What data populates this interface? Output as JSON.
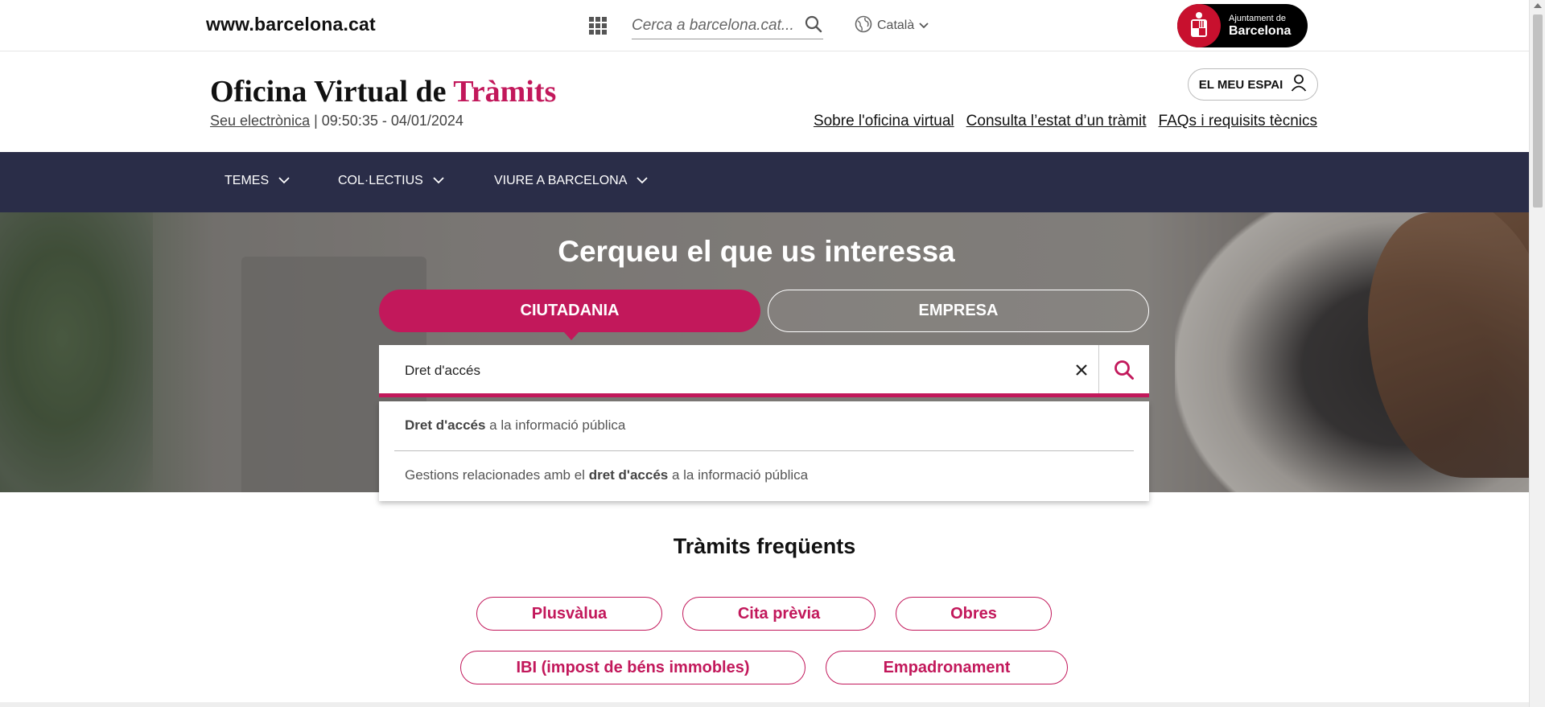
{
  "topbar": {
    "site_link": "www.barcelona.cat",
    "search_placeholder": "Cerca a barcelona.cat...",
    "language": "Català",
    "logo_line1": "Ajuntament de",
    "logo_line2": "Barcelona"
  },
  "header": {
    "title_part1": "Oficina Virtual de ",
    "title_part2": "Tràmits",
    "sub_link": "Seu electrònica",
    "datetime": "| 09:50:35 - 04/01/2024",
    "my_space": "EL MEU ESPAI",
    "links": [
      "Sobre l'oficina virtual",
      "Consulta l’estat d’un tràmit",
      "FAQs i requisits tècnics"
    ]
  },
  "nav": {
    "items": [
      "TEMES",
      "COL·LECTIUS",
      "VIURE A BARCELONA"
    ]
  },
  "hero": {
    "title": "Cerqueu el que us interessa",
    "tab_active": "CIUTADANIA",
    "tab_other": "EMPRESA"
  },
  "search": {
    "value": "Dret d'accés",
    "suggestions": [
      {
        "pre": "",
        "bold": "Dret d'accés",
        "post": " a la informació pública"
      },
      {
        "pre": "Gestions relacionades amb el ",
        "bold": "dret d'accés",
        "post": " a la informació pública"
      }
    ]
  },
  "frequent": {
    "title": "Tràmits freqüents",
    "items": [
      "Plusvàlua",
      "Cita prèvia",
      "Obres",
      "IBI (impost de béns immobles)",
      "Empadronament"
    ]
  },
  "colors": {
    "accent": "#c2185b",
    "nav_bg": "#2a2d48",
    "logo_bg": "#000000"
  }
}
